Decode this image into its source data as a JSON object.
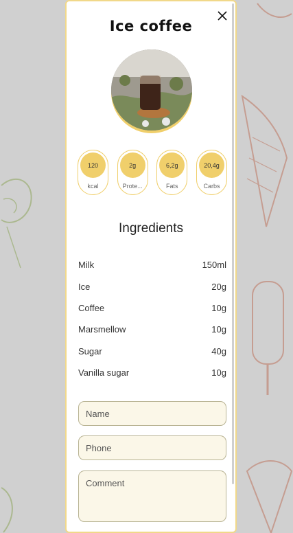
{
  "modal": {
    "title": "Ice coffee",
    "close_icon": "close-icon"
  },
  "nutrients": [
    {
      "value": "120",
      "label": "kcal"
    },
    {
      "value": "2g",
      "label": "Prote..."
    },
    {
      "value": "6,2g",
      "label": "Fats"
    },
    {
      "value": "20,4g",
      "label": "Carbs"
    }
  ],
  "ingredients": {
    "title": "Ingredients",
    "items": [
      {
        "name": "Milk",
        "amount": "150ml"
      },
      {
        "name": "Ice",
        "amount": "20g"
      },
      {
        "name": "Coffee",
        "amount": "10g"
      },
      {
        "name": "Marsmellow",
        "amount": "10g"
      },
      {
        "name": "Sugar",
        "amount": "40g"
      },
      {
        "name": "Vanilla sugar",
        "amount": "10g"
      }
    ]
  },
  "form": {
    "name_placeholder": "Name",
    "phone_placeholder": "Phone",
    "comment_placeholder": "Comment"
  },
  "colors": {
    "accent": "#f0cf6b",
    "field_bg": "#fbf7e8"
  }
}
